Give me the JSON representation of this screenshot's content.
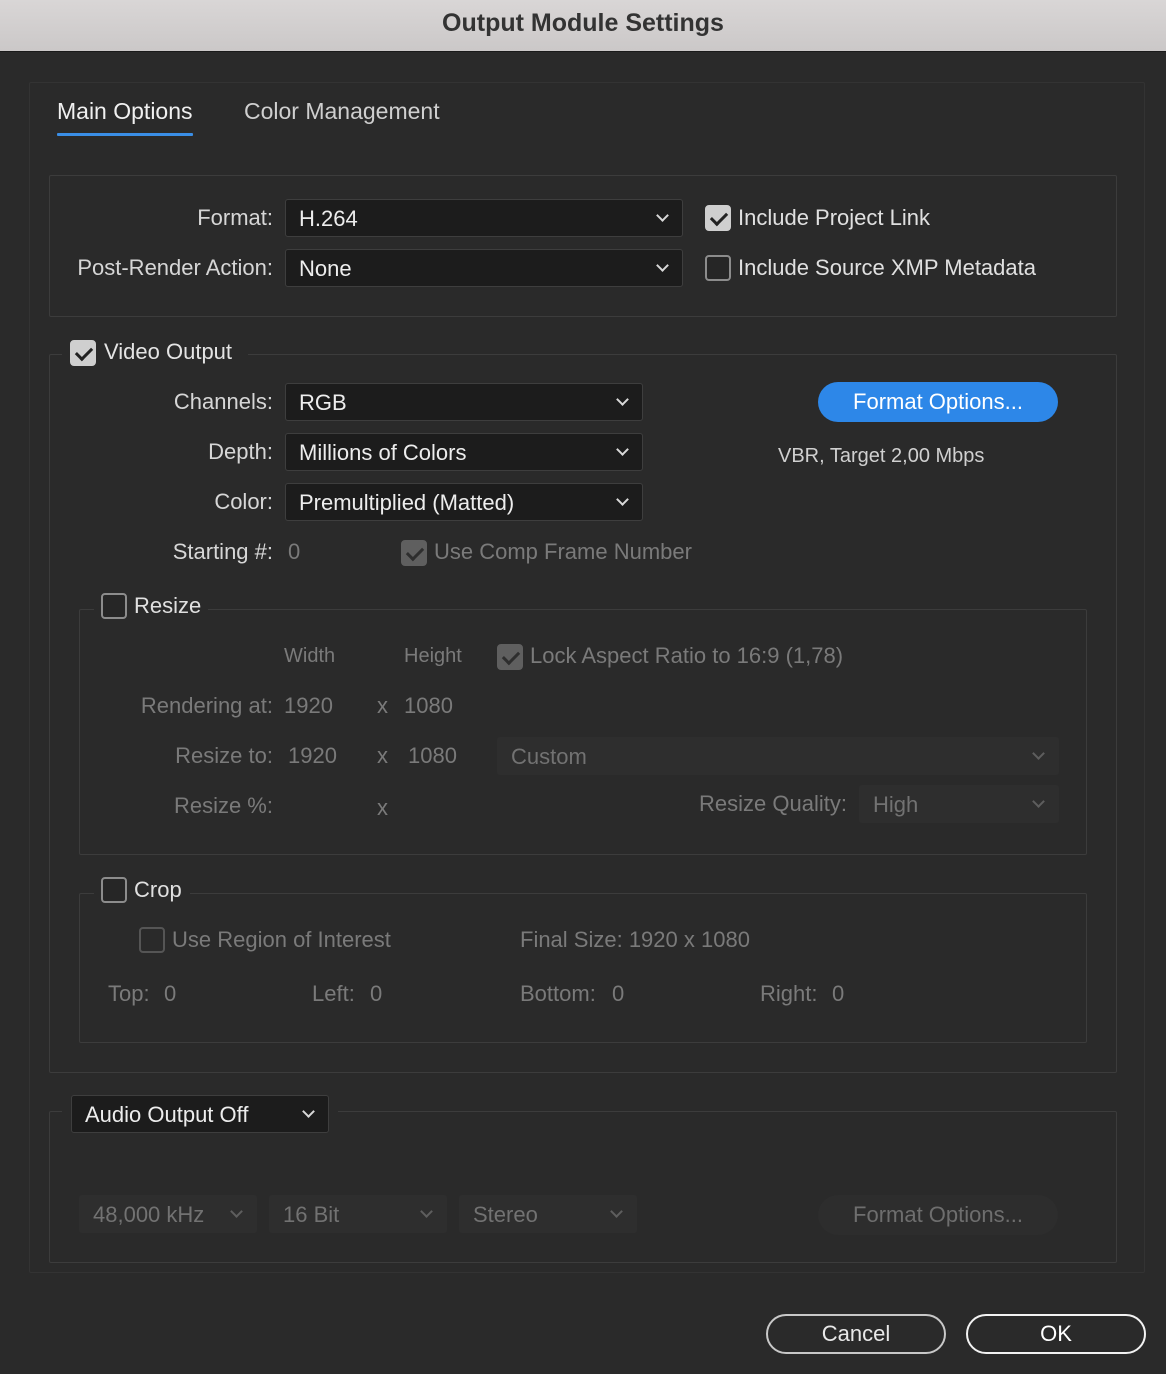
{
  "window": {
    "title": "Output Module Settings"
  },
  "tabs": [
    {
      "label": "Main Options",
      "active": true
    },
    {
      "label": "Color Management",
      "active": false
    }
  ],
  "format_section": {
    "format_label": "Format:",
    "format_value": "H.264",
    "post_render_label": "Post-Render Action:",
    "post_render_value": "None",
    "include_project_link": {
      "label": "Include Project Link",
      "checked": true
    },
    "include_xmp": {
      "label": "Include Source XMP Metadata",
      "checked": false
    }
  },
  "video_output": {
    "label": "Video Output",
    "checked": true,
    "channels_label": "Channels:",
    "channels_value": "RGB",
    "depth_label": "Depth:",
    "depth_value": "Millions of Colors",
    "color_label": "Color:",
    "color_value": "Premultiplied (Matted)",
    "starting_label": "Starting #:",
    "starting_value": "0",
    "use_comp_frame": {
      "label": "Use Comp Frame Number",
      "checked": true
    },
    "format_options_label": "Format Options...",
    "format_summary": "VBR, Target 2,00 Mbps"
  },
  "resize": {
    "label": "Resize",
    "checked": false,
    "width_header": "Width",
    "height_header": "Height",
    "lock_aspect": {
      "label": "Lock Aspect Ratio to 16:9 (1,78)",
      "checked": true
    },
    "rendering_label": "Rendering at:",
    "rendering_width": "1920",
    "rendering_height": "1080",
    "resize_to_label": "Resize to:",
    "resize_to_width": "1920",
    "resize_to_height": "1080",
    "preset_value": "Custom",
    "resize_pct_label": "Resize %:",
    "times": "x",
    "quality_label": "Resize Quality:",
    "quality_value": "High"
  },
  "crop": {
    "label": "Crop",
    "checked": false,
    "use_roi": {
      "label": "Use Region of Interest",
      "checked": false
    },
    "final_size": "Final Size: 1920 x 1080",
    "top_label": "Top:",
    "top_value": "0",
    "left_label": "Left:",
    "left_value": "0",
    "bottom_label": "Bottom:",
    "bottom_value": "0",
    "right_label": "Right:",
    "right_value": "0"
  },
  "audio": {
    "output_value": "Audio Output Off",
    "rate_value": "48,000 kHz",
    "bits_value": "16 Bit",
    "channels_value": "Stereo",
    "format_options_label": "Format Options..."
  },
  "buttons": {
    "cancel": "Cancel",
    "ok": "OK"
  },
  "colors": {
    "accent": "#2d87e8",
    "background": "#2a2a2a",
    "field": "#1c1c1c"
  }
}
